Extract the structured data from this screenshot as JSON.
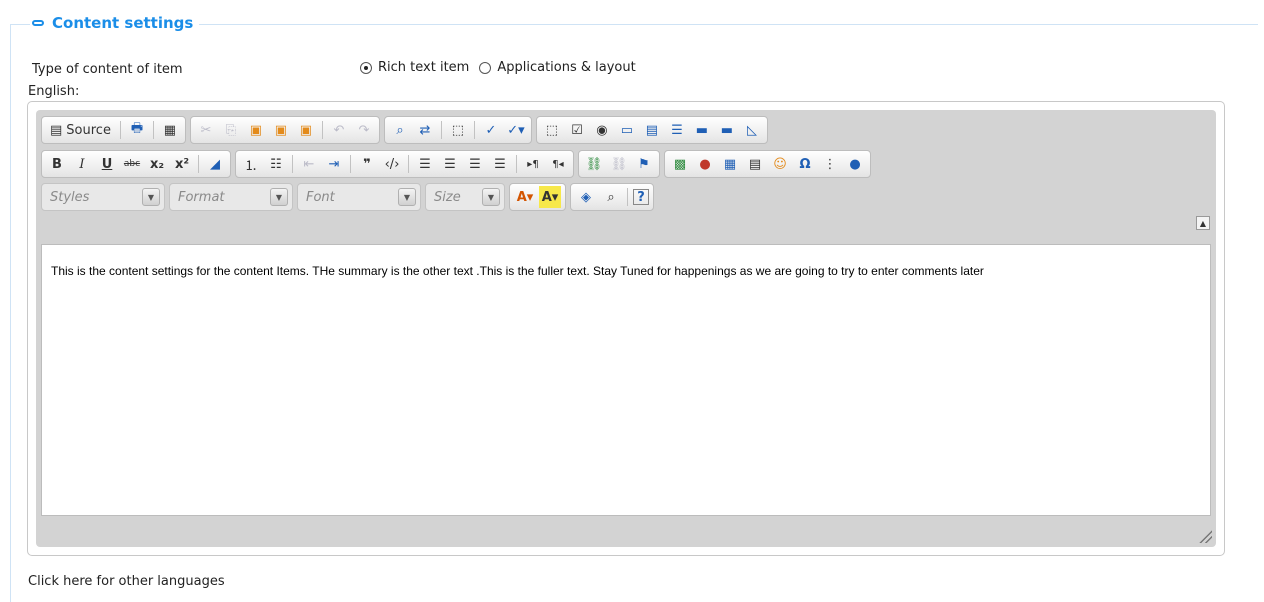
{
  "section": {
    "title": "Content settings"
  },
  "type_field": {
    "label": "Type of content of item",
    "options": [
      {
        "label": "Rich text item",
        "selected": true
      },
      {
        "label": "Applications & layout",
        "selected": false
      }
    ]
  },
  "language_label": "English:",
  "editor": {
    "toolbar": {
      "source_label": "Source",
      "styles_placeholder": "Styles",
      "format_placeholder": "Format",
      "font_placeholder": "Font",
      "size_placeholder": "Size"
    },
    "content": "This is the content settings for the content Items.   THe summary is the other text .This is the fuller text.   Stay Tuned for happenings as we are going to try to enter comments later"
  },
  "other_languages_link": "Click here for other languages"
}
